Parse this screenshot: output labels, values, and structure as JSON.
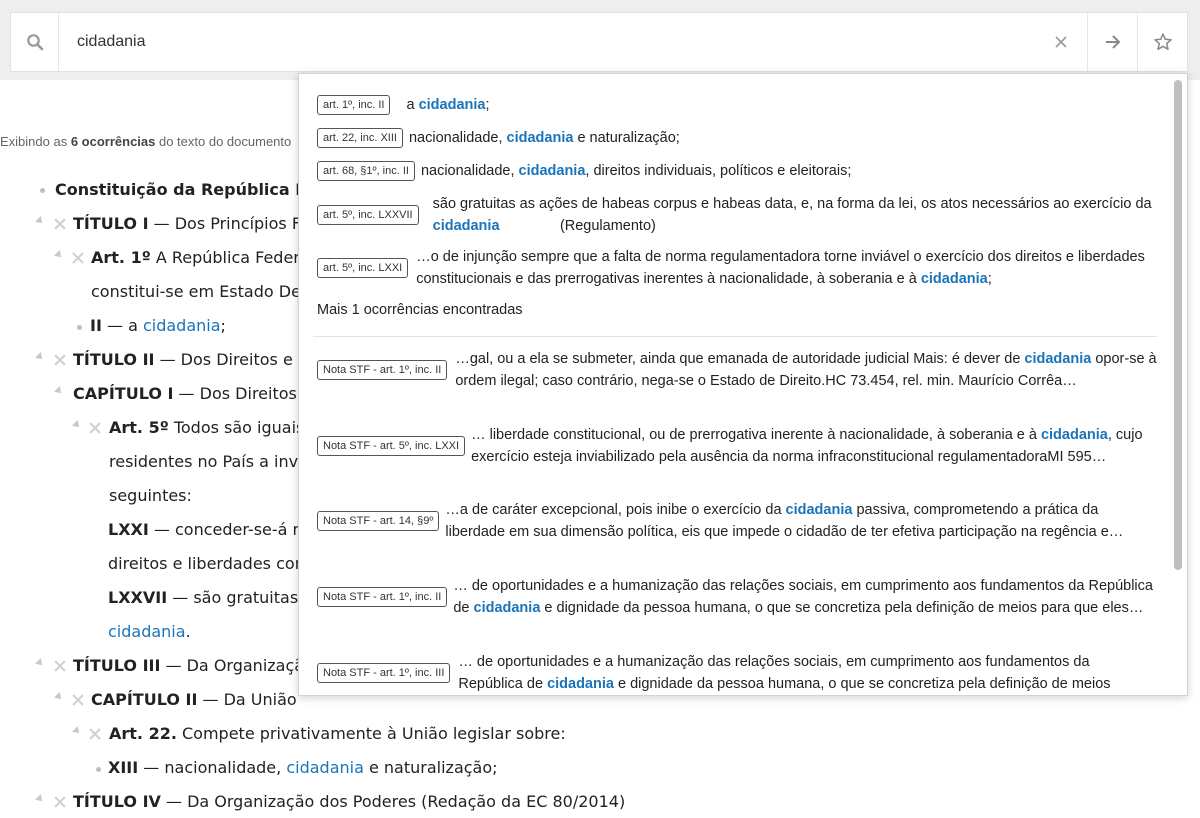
{
  "search": {
    "value": "cidadania",
    "icon": "search-icon",
    "clear_icon": "close-icon",
    "go_icon": "arrow-right-icon",
    "fav_icon": "star-icon"
  },
  "results_info": {
    "prefix": "Exibindo as ",
    "count": "6 ocorrências",
    "suffix": " do texto do documento "
  },
  "document": {
    "title": "Constituição da República Fede",
    "t1_head": "TÍTULO I",
    "t1_rest": " — Dos Princípios Fu",
    "art1_head": "Art. 1º",
    "art1_rest": " A República Federat",
    "art1_line2": "constitui-se em Estado Der",
    "inc2_head": "II",
    "inc2_pre": " — a ",
    "inc2_hl": "cidadania",
    "inc2_post": ";",
    "t2_head": "TÍTULO II",
    "t2_rest": " — Dos Direitos e G",
    "cap1_head": "CAPÍTULO I",
    "cap1_rest": " — Dos Direitos e",
    "art5_head": "Art. 5º",
    "art5_rest": " Todos são iguais p",
    "art5_line2": "residentes no País a invio",
    "art5_line3": "seguintes:",
    "lxxi_head": "LXXI",
    "lxxi_rest": " — conceder-se-á ma",
    "lxxi_line2": "direitos e liberdades cons",
    "lxxvii_head": "LXXVII",
    "lxxvii_rest": " — são gratuitas as",
    "lxxvii_hl": "cidadania",
    "lxxvii_post": ".",
    "t3_head": "TÍTULO III",
    "t3_rest": " — Da Organização",
    "cap2_head": "CAPÍTULO II",
    "cap2_rest": " — Da União",
    "art22_head": "Art. 22.",
    "art22_rest": " Compete privativamente à União legislar sobre:",
    "xiii_head": "XIII",
    "xiii_pre": " — nacionalidade, ",
    "xiii_hl": "cidadania",
    "xiii_post": " e naturalização;",
    "t4_head": "TÍTULO IV",
    "t4_rest": " — Da Organização dos Poderes (Redação da EC 80/2014)"
  },
  "dropdown": {
    "items": [
      {
        "tag": "art. 1º, inc. II",
        "pre": "a ",
        "hl": "cidadania",
        "post": ";"
      },
      {
        "tag": "art. 22, inc. XIII",
        "pre": "nacionalidade, ",
        "hl": "cidadania",
        "post": " e naturalização;"
      },
      {
        "tag": "art. 68, §1º, inc. II",
        "pre": "nacionalidade, ",
        "hl": "cidadania",
        "post": ", direitos individuais, políticos e eleitorais;"
      },
      {
        "tag": "art. 5º, inc. LXXVII",
        "pre": "são gratuitas as ações de habeas corpus e habeas data, e, na forma da lei, os atos necessários ao exercício da ",
        "hl": "cidadania",
        "post": "               (Regulamento)"
      },
      {
        "tag": "art. 5º, inc. LXXI",
        "pre": "…o de injunção sempre que a falta de norma regulamentadora torne inviável o exercício dos direitos e liberdades constitucionais e das prerrogativas inerentes à nacionalidade, à soberania e à ",
        "hl": "cidadania",
        "post": ";"
      }
    ],
    "more": "Mais 1 ocorrências encontradas",
    "notes": [
      {
        "tag": "Nota STF - art. 1º, inc. II",
        "pre": "…gal, ou a ela se submeter, ainda que emanada de autoridade judicial Mais: é dever de ",
        "hl": "cidadania",
        "post": " opor-se à ordem ilegal; caso contrário, nega-se o Estado de Direito.HC 73.454, rel. min. Maurício Corrêa…"
      },
      {
        "tag": "Nota STF - art. 5º, inc. LXXI",
        "pre": "… liberdade constitucional, ou de prerrogativa inerente à nacionalidade, à soberania e à ",
        "hl": "cidadania",
        "post": ", cujo exercício esteja inviabilizado pela ausência da norma infraconstitucional regulamentadoraMI 595…"
      },
      {
        "tag": "Nota STF - art. 14, §9º",
        "pre": "…a de caráter excepcional, pois inibe o exercício da ",
        "hl": "cidadania",
        "post": " passiva, comprometendo a prática da liberdade em sua dimensão política, eis que impede o cidadão de ter efetiva participação na regência e…"
      },
      {
        "tag": "Nota STF - art. 1º, inc. II",
        "pre": "… de oportunidades e a humanização das relações sociais, em cumprimento aos fundamentos da República de ",
        "hl": "cidadania",
        "post": " e dignidade da pessoa humana, o que se concretiza pela definição de meios para que eles…"
      },
      {
        "tag": "Nota STF - art. 1º, inc. III",
        "pre": "… de oportunidades e a humanização das relações sociais, em cumprimento aos fundamentos da República de ",
        "hl": "cidadania",
        "post": " e dignidade da pessoa humana, o que se concretiza pela definição de meios"
      }
    ]
  }
}
